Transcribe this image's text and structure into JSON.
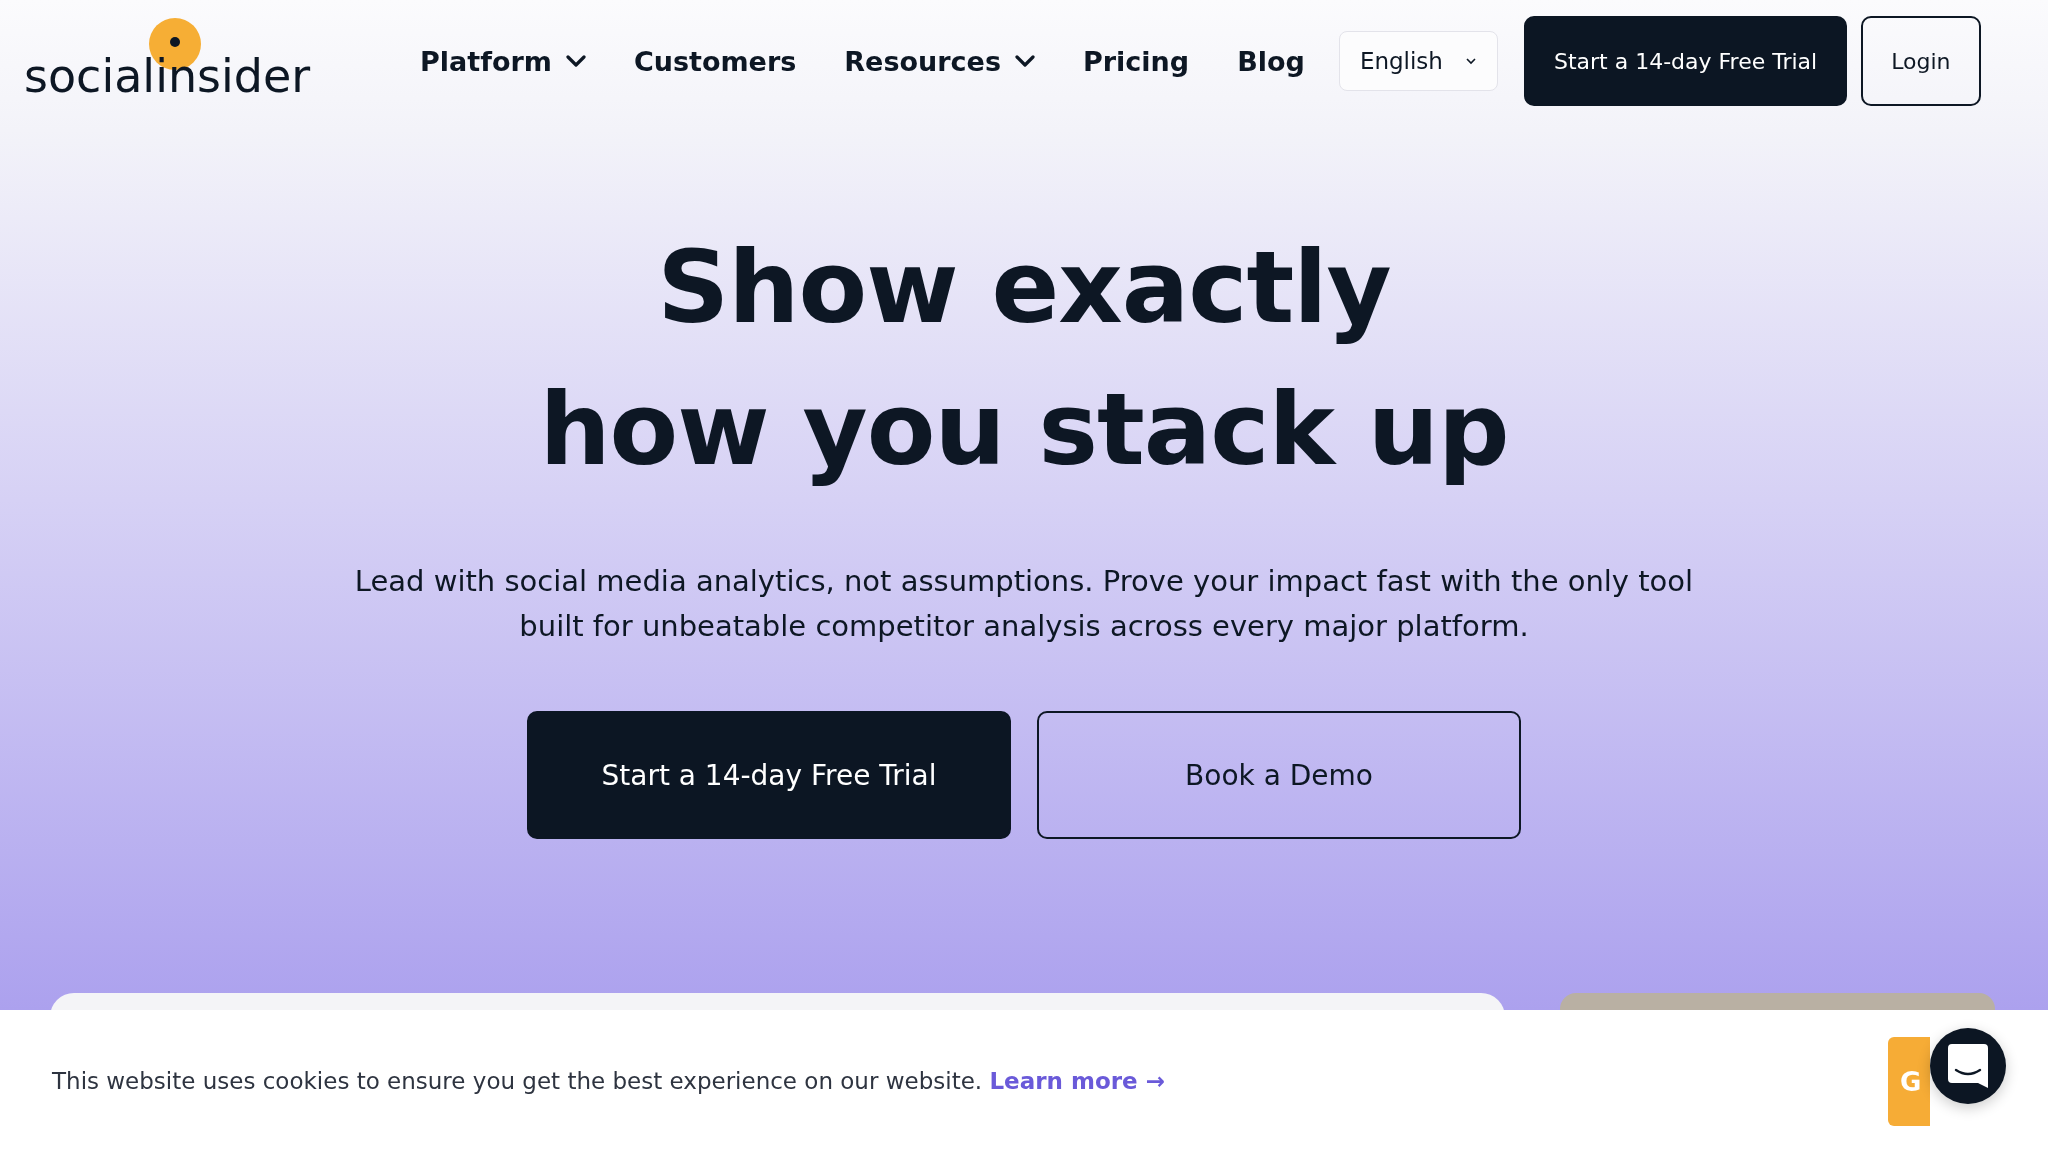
{
  "logo": {
    "text": "socialinsider"
  },
  "nav": [
    {
      "label": "Platform",
      "dropdown": true
    },
    {
      "label": "Customers",
      "dropdown": false
    },
    {
      "label": "Resources",
      "dropdown": true
    },
    {
      "label": "Pricing",
      "dropdown": false
    },
    {
      "label": "Blog",
      "dropdown": false
    }
  ],
  "language_select": {
    "value": "English"
  },
  "header_buttons": [
    {
      "label": "Start a 14-day Free Trial",
      "kind": "primary"
    },
    {
      "label": "Login",
      "kind": "outline"
    }
  ],
  "hero": {
    "title_lines": [
      "Show exactly",
      "how you stack up"
    ],
    "subtitle": "Lead with social media analytics, not assumptions. Prove your impact fast with the only tool built for unbeatable competitor analysis across every major platform.",
    "buttons": [
      {
        "label": "Start a 14-day Free Trial",
        "kind": "primary"
      },
      {
        "label": "Book a Demo",
        "kind": "outline"
      }
    ]
  },
  "cookie_bar": {
    "text": "This website uses cookies to ensure you get the best experience on our website.",
    "link": "Learn more →",
    "button": "G"
  }
}
